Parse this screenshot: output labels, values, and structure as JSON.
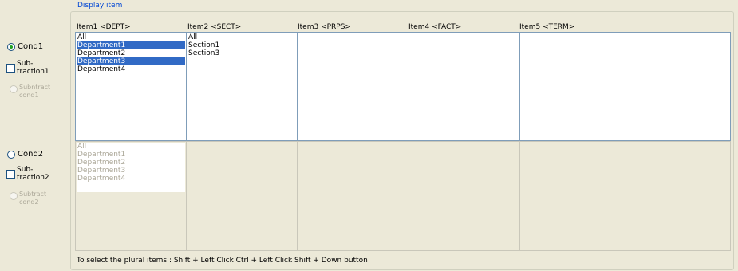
{
  "group_label": "Display item",
  "hint": "To select the plural items : Shift + Left Click  Ctrl + Left Click  Shift + Down button",
  "columns": [
    "Item1 <DEPT>",
    "Item2 <SECT>",
    "Item3 <PRPS>",
    "Item4 <FACT>",
    "Item5 <TERM>"
  ],
  "cond1": {
    "radio_label": "Cond1",
    "radio_checked": true,
    "subtraction_label_line1": "Sub-",
    "subtraction_label_line2": "traction1",
    "subtract_label_line1": "Subntract",
    "subtract_label_line2": "cond1",
    "dept_items": [
      {
        "label": "All",
        "selected": false
      },
      {
        "label": "Department1",
        "selected": true
      },
      {
        "label": "Department2",
        "selected": false
      },
      {
        "label": "Department3",
        "selected": true
      },
      {
        "label": "Department4",
        "selected": false
      }
    ],
    "sect_items": [
      {
        "label": "All",
        "selected": false
      },
      {
        "label": "Section1",
        "selected": false
      },
      {
        "label": "Section3",
        "selected": false
      }
    ]
  },
  "cond2": {
    "radio_label": "Cond2",
    "radio_checked": false,
    "subtraction_label_line1": "Sub-",
    "subtraction_label_line2": "traction2",
    "subtract_label_line1": "Subtract",
    "subtract_label_line2": "cond2",
    "dept_items": [
      {
        "label": "All"
      },
      {
        "label": "Department1"
      },
      {
        "label": "Department2"
      },
      {
        "label": "Department3"
      },
      {
        "label": "Department4"
      }
    ]
  }
}
